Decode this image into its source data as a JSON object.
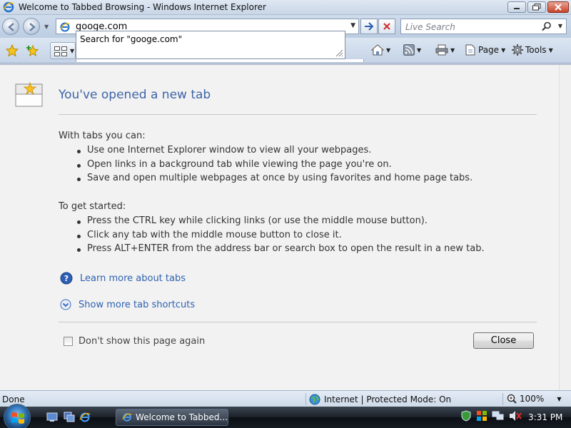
{
  "window": {
    "title": "Welcome to Tabbed Browsing - Windows Internet Explorer"
  },
  "address_bar": {
    "value": "googe.com",
    "suggestion": "Search for \"googe.com\""
  },
  "search": {
    "placeholder": "Live Search"
  },
  "command_bar": {
    "page_label": "Page",
    "tools_label": "Tools"
  },
  "content": {
    "heading": "You've opened a new tab",
    "with_tabs_title": "With tabs you can:",
    "with_tabs_items": [
      "Use one Internet Explorer window to view all your webpages.",
      "Open links in a background tab while viewing the page you're on.",
      "Save and open multiple webpages at once by using favorites and home page tabs."
    ],
    "get_started_title": "To get started:",
    "get_started_items": [
      "Press the CTRL key while clicking links (or use the middle mouse button).",
      "Click any tab with the middle mouse button to close it.",
      "Press ALT+ENTER from the address bar or search box to open the result in a new tab."
    ],
    "learn_more_link": "Learn more about tabs",
    "shortcuts_link": "Show more tab shortcuts",
    "dont_show_label": "Don't show this page again",
    "close_button": "Close"
  },
  "status_bar": {
    "status": "Done",
    "zone": "Internet | Protected Mode: On",
    "zoom": "100%"
  },
  "taskbar": {
    "task_label": "Welcome to Tabbed...",
    "clock": "3:31 PM"
  },
  "colors": {
    "link": "#2e62b0",
    "heading": "#3d64a8"
  }
}
